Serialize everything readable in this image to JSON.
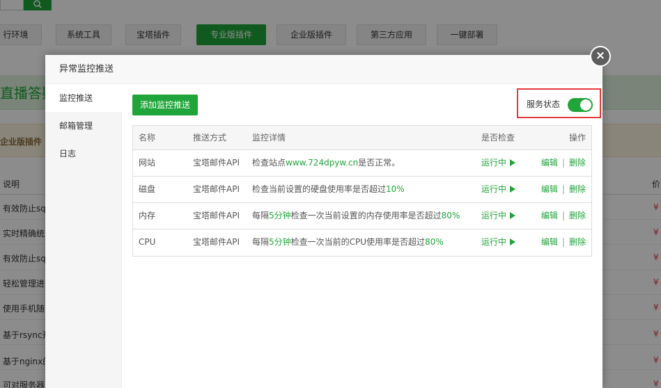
{
  "background": {
    "search_button_icon": "search-icon",
    "tabs": [
      {
        "label": "运行环境",
        "display": "行环境",
        "active": false
      },
      {
        "label": "系统工具",
        "active": false
      },
      {
        "label": "宝塔插件",
        "active": false
      },
      {
        "label": "专业版插件",
        "active": true
      },
      {
        "label": "企业版插件",
        "active": false
      },
      {
        "label": "第三方应用",
        "active": false
      },
      {
        "label": "一键部署",
        "active": false
      }
    ],
    "banner_text": "直播答疑",
    "category_text": "企业版插件",
    "table_header": {
      "left": "说明",
      "right": "价"
    },
    "rows": [
      {
        "text": "有效防止sq",
        "price": "¥"
      },
      {
        "text": "实时精确统",
        "price": "¥"
      },
      {
        "text": "有效防止sq",
        "price": "¥"
      },
      {
        "text": "轻松管理进",
        "price": "¥"
      },
      {
        "text": "使用手机随",
        "price": "¥"
      },
      {
        "text": "基于rsync开",
        "price": "¥"
      },
      {
        "text": "基于nginx的",
        "price": "¥"
      },
      {
        "text": "可对服务器",
        "price": "¥"
      }
    ]
  },
  "modal": {
    "title": "异常监控推送",
    "close_icon": "close-icon",
    "sidebar": [
      {
        "label": "监控推送",
        "active": true
      },
      {
        "label": "邮箱管理",
        "active": false
      },
      {
        "label": "日志",
        "active": false
      }
    ],
    "add_button": "添加监控推送",
    "service_status_label": "服务状态",
    "service_status_on": true,
    "table": {
      "headers": [
        "名称",
        "推送方式",
        "监控详情",
        "是否检查",
        "操作"
      ],
      "rows": [
        {
          "name": "网站",
          "method": "宝塔邮件API",
          "detail_parts": [
            "检查站点",
            "www.724dpyw.cn",
            "是否正常。"
          ],
          "check": "运行中",
          "edit": "编辑",
          "delete": "删除"
        },
        {
          "name": "磁盘",
          "method": "宝塔邮件API",
          "detail_parts": [
            "检查当前设置的硬盘使用率是否超过",
            "10%",
            ""
          ],
          "check": "运行中",
          "edit": "编辑",
          "delete": "删除"
        },
        {
          "name": "内存",
          "method": "宝塔邮件API",
          "detail_parts": [
            "每隔",
            "5分钟",
            "检查一次当前设置的内存使用率是否超过",
            "80%"
          ],
          "check": "运行中",
          "edit": "编辑",
          "delete": "删除"
        },
        {
          "name": "CPU",
          "method": "宝塔邮件API",
          "detail_parts": [
            "每隔",
            "5分钟",
            "检查一次当前的CPU使用率是否超过",
            "80%"
          ],
          "check": "运行中",
          "edit": "编辑",
          "delete": "删除"
        }
      ]
    }
  },
  "colors": {
    "accent": "#20a53a",
    "highlight_border": "#e4393c"
  }
}
